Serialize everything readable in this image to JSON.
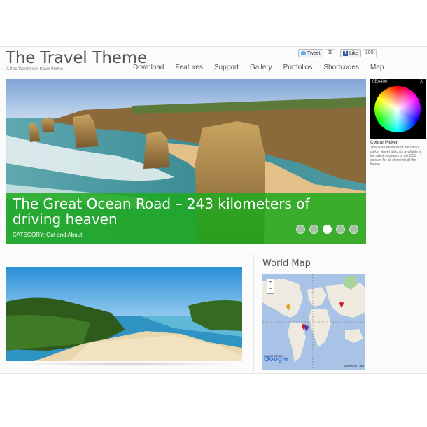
{
  "site": {
    "title": "The Travel Theme",
    "tagline": "A free Wordpress travel theme"
  },
  "social": {
    "tweet_label": "Tweet",
    "tweet_count": "38",
    "like_label": "Like",
    "like_count": "105"
  },
  "nav": {
    "items": [
      "Download",
      "Features",
      "Support",
      "Gallery",
      "Portfolios",
      "Shortcodes",
      "Map"
    ]
  },
  "slider": {
    "title": "The Great Ocean Road – 243 kilometers of driving heaven",
    "category": "CATEGORY: Out and About",
    "slide_count": 5,
    "active_slide": 3,
    "caption_color": "#1eaa1e"
  },
  "picker": {
    "hex": "0BA400",
    "close": "X",
    "title": "Colour Picker",
    "description": "This is an example of the colour picker wheel which is available in the admin screens to set CSS colours for all elements of the theme"
  },
  "world_map": {
    "title": "World Map",
    "zoom_in": "+",
    "zoom_out": "−",
    "powered_by": "POWERED BY",
    "google": "Google",
    "terms": "Terms of Use"
  }
}
